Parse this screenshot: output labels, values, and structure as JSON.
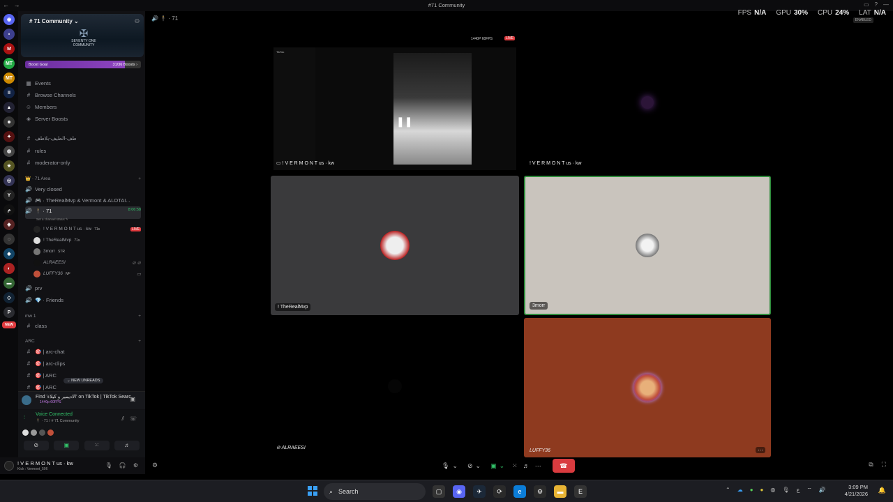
{
  "window": {
    "title": "#71 Community",
    "nav": "← →"
  },
  "overlay": {
    "fps_label": "FPS",
    "fps": "N/A",
    "gpu_label": "GPU",
    "gpu": "30%",
    "cpu_label": "CPU",
    "cpu": "24%",
    "lat_label": "LAT",
    "lat": "N/A",
    "enabled": "ENABLED"
  },
  "server": {
    "name": "# 71 Community ⌄",
    "banner_line1": "SEVENTY ONE",
    "banner_line2": "COMMUNITY",
    "boost_label": "Boost Goal",
    "boost_count": "31/36 Boosts ›",
    "boost_progress": 0.86
  },
  "sidebar": {
    "menu": [
      {
        "icon": "calendar-icon",
        "label": "Events"
      },
      {
        "icon": "browse-icon",
        "label": "Browse Channels"
      },
      {
        "icon": "members-icon",
        "label": "Members"
      },
      {
        "icon": "boost-icon",
        "label": "Server Boosts"
      }
    ],
    "text_channels": [
      {
        "label": "طف-الطيف-بلاطف"
      },
      {
        "label": "rules"
      },
      {
        "label": "moderator-only"
      }
    ],
    "category_71": "👑 · 71 Area",
    "voice_channels": [
      {
        "label": "Very closed"
      },
      {
        "label": "🎮 · TheRealMvp & Vermont & ALOTAI..."
      }
    ],
    "active_channel": {
      "label": "🕴 · 71",
      "time": "8:06:58",
      "status": "Set a channel status ✎"
    },
    "voice_users": [
      {
        "name": "! V E R M O N T us · kw",
        "badge": "71s",
        "live": "LIVE"
      },
      {
        "name": "! TheRealMvp",
        "badge": "71s"
      },
      {
        "name": "3morr",
        "badge": "STR"
      },
      {
        "name": "ALRAEESI",
        "badge": ""
      },
      {
        "name": "LUFFY36",
        "badge": "NF"
      }
    ],
    "more_voice": [
      {
        "label": "prv"
      },
      {
        "label": "💎 · Friends"
      }
    ],
    "category_mw": "mw 1",
    "mw_channels": [
      {
        "label": "class"
      }
    ],
    "category_arc": "ARC",
    "arc_channels": [
      {
        "label": "🎯 | arc-chat"
      },
      {
        "label": "🎯 | arc-clips"
      },
      {
        "label": "🎯 | ARC"
      },
      {
        "label": "🎯 | ARC"
      }
    ],
    "new_unreads": "NEW UNREADS",
    "new_badge": "NEW"
  },
  "activity": {
    "text": "Find 'الاديمير و كيلاء' on TikTok | TikTok Searc...",
    "sub": "1440p 60FPS"
  },
  "voice_panel": {
    "status": "Voice Connected",
    "channel": "🕴 · 71 / # 71 Community"
  },
  "user": {
    "name": "! V E R M O N T us · kw",
    "status": "Kick : Vermont_506"
  },
  "call_header": "🕴 · 71",
  "stream": {
    "quality": "1440P 60FPS",
    "live": "LIVE",
    "app_title": "TikTok",
    "label": "! V E R M O N T us · kw"
  },
  "tiles": [
    {
      "label": "! V E R M O N T us · kw"
    },
    {
      "label": "! TheRealMvp"
    },
    {
      "label": "3morr"
    },
    {
      "label": "ALRAEESI"
    },
    {
      "label": "LUFFY36"
    }
  ],
  "taskbar": {
    "search_placeholder": "Search",
    "time": "3:09 PM",
    "date": "4/21/2026"
  },
  "colors": {
    "accent": "#8e44c0",
    "live": "#e03a3e",
    "voice_green": "#33c46a",
    "end_call": "#d93b3f",
    "tile_grey": "#3a3a3c",
    "tile_beige": "#c9c4bd",
    "tile_orange": "#8e3a1f"
  }
}
